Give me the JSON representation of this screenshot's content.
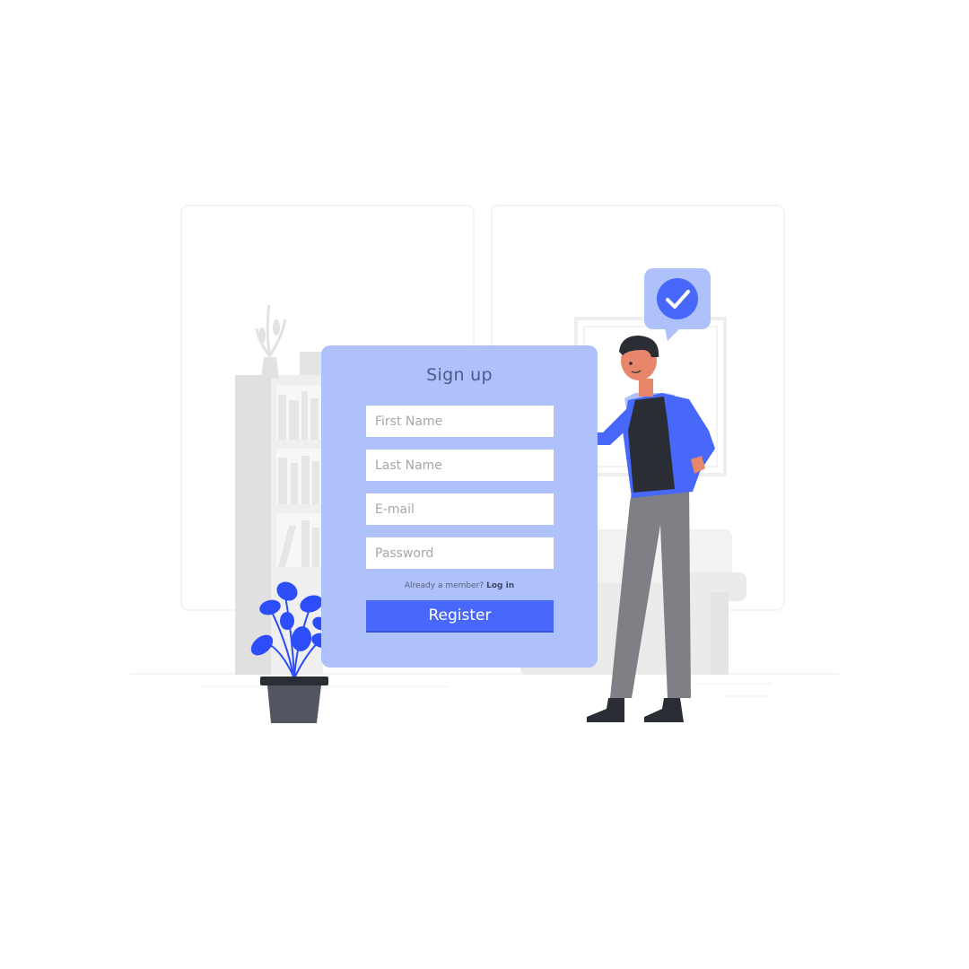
{
  "signup": {
    "title": "Sign up",
    "fields": {
      "first_name": {
        "placeholder": "First Name",
        "value": ""
      },
      "last_name": {
        "placeholder": "Last Name",
        "value": ""
      },
      "email": {
        "placeholder": "E-mail",
        "value": ""
      },
      "password": {
        "placeholder": "Password",
        "value": ""
      }
    },
    "member_prompt": "Already a member?",
    "login_link": "Log in",
    "register_label": "Register"
  },
  "icons": {
    "speech_bubble": "check-circle-icon",
    "plant": "potted-plant-icon",
    "vase": "vase-icon"
  },
  "colors": {
    "accent": "#4768fa",
    "card": "#aec1fb",
    "bubble": "#aec1fb",
    "title": "#4a5d8c"
  }
}
